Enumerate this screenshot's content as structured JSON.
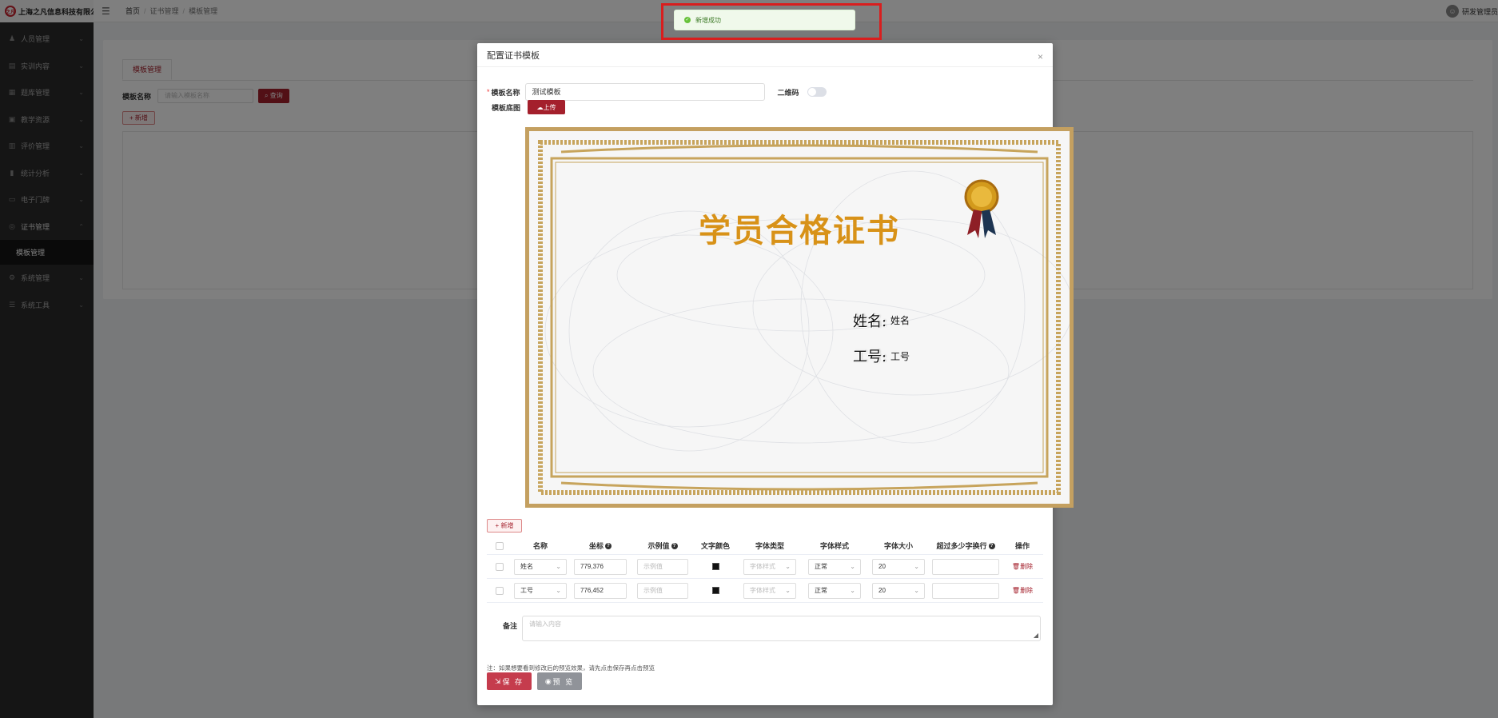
{
  "company": {
    "name": "上海之凡信息科技有限公司",
    "logo_text": "之凡"
  },
  "sidebar": {
    "items": [
      {
        "label": "人员管理",
        "icon": "person-icon"
      },
      {
        "label": "实训内容",
        "icon": "book-icon"
      },
      {
        "label": "题库管理",
        "icon": "doc-icon"
      },
      {
        "label": "教学资源",
        "icon": "folder-icon"
      },
      {
        "label": "评价管理",
        "icon": "star-icon"
      },
      {
        "label": "统计分析",
        "icon": "chart-icon"
      },
      {
        "label": "电子门牌",
        "icon": "monitor-icon"
      },
      {
        "label": "证书管理",
        "icon": "certificate-icon"
      },
      {
        "label": "模板管理",
        "icon": ""
      },
      {
        "label": "系统管理",
        "icon": "gear-icon"
      },
      {
        "label": "系统工具",
        "icon": "tool-icon"
      }
    ]
  },
  "header": {
    "breadcrumb": [
      "首页",
      "证书管理",
      "模板管理"
    ],
    "user": "研发管理员"
  },
  "page": {
    "tab": "模板管理",
    "filter_label": "模板名称",
    "filter_placeholder": "请输入模板名称",
    "query_button": "查询",
    "add_button": "新增"
  },
  "toast": {
    "message": "新增成功",
    "type": "success",
    "color": "#67c23a"
  },
  "dialog": {
    "title": "配置证书模板",
    "name_label": "模板名称",
    "name_value": "测试模板",
    "qrcode_label": "二维码",
    "qrcode_enabled": false,
    "bg_label": "模板底图",
    "upload_button": "上传",
    "certificate": {
      "title": "学员合格证书",
      "fields": [
        {
          "label": "姓名:",
          "value": "姓名"
        },
        {
          "label": "工号:",
          "value": "工号"
        }
      ]
    },
    "add_button": "新增",
    "columns": [
      "名称",
      "坐标",
      "示例值",
      "文字颜色",
      "字体类型",
      "字体样式",
      "字体大小",
      "超过多少字换行",
      "操作"
    ],
    "rows": [
      {
        "name": "姓名",
        "coord": "779,376",
        "sample_placeholder": "示例值",
        "color": "#000000",
        "font_type_placeholder": "字体样式",
        "font_style": "正常",
        "font_size": "20",
        "wrap": "",
        "action": "删除"
      },
      {
        "name": "工号",
        "coord": "776,452",
        "sample_placeholder": "示例值",
        "color": "#000000",
        "font_type_placeholder": "字体样式",
        "font_style": "正常",
        "font_size": "20",
        "wrap": "",
        "action": "删除"
      }
    ],
    "remark_label": "备注",
    "remark_placeholder": "请输入内容",
    "note": "注：如果想要看到修改后的预览效果，请先点击保存再点击预览",
    "save_button": "保 存",
    "preview_button": "预 览"
  },
  "colors": {
    "brand": "#a4202c",
    "sidebar": "#2b2b2b",
    "cert_title": "#d89218",
    "cert_border": "#c4a060"
  }
}
